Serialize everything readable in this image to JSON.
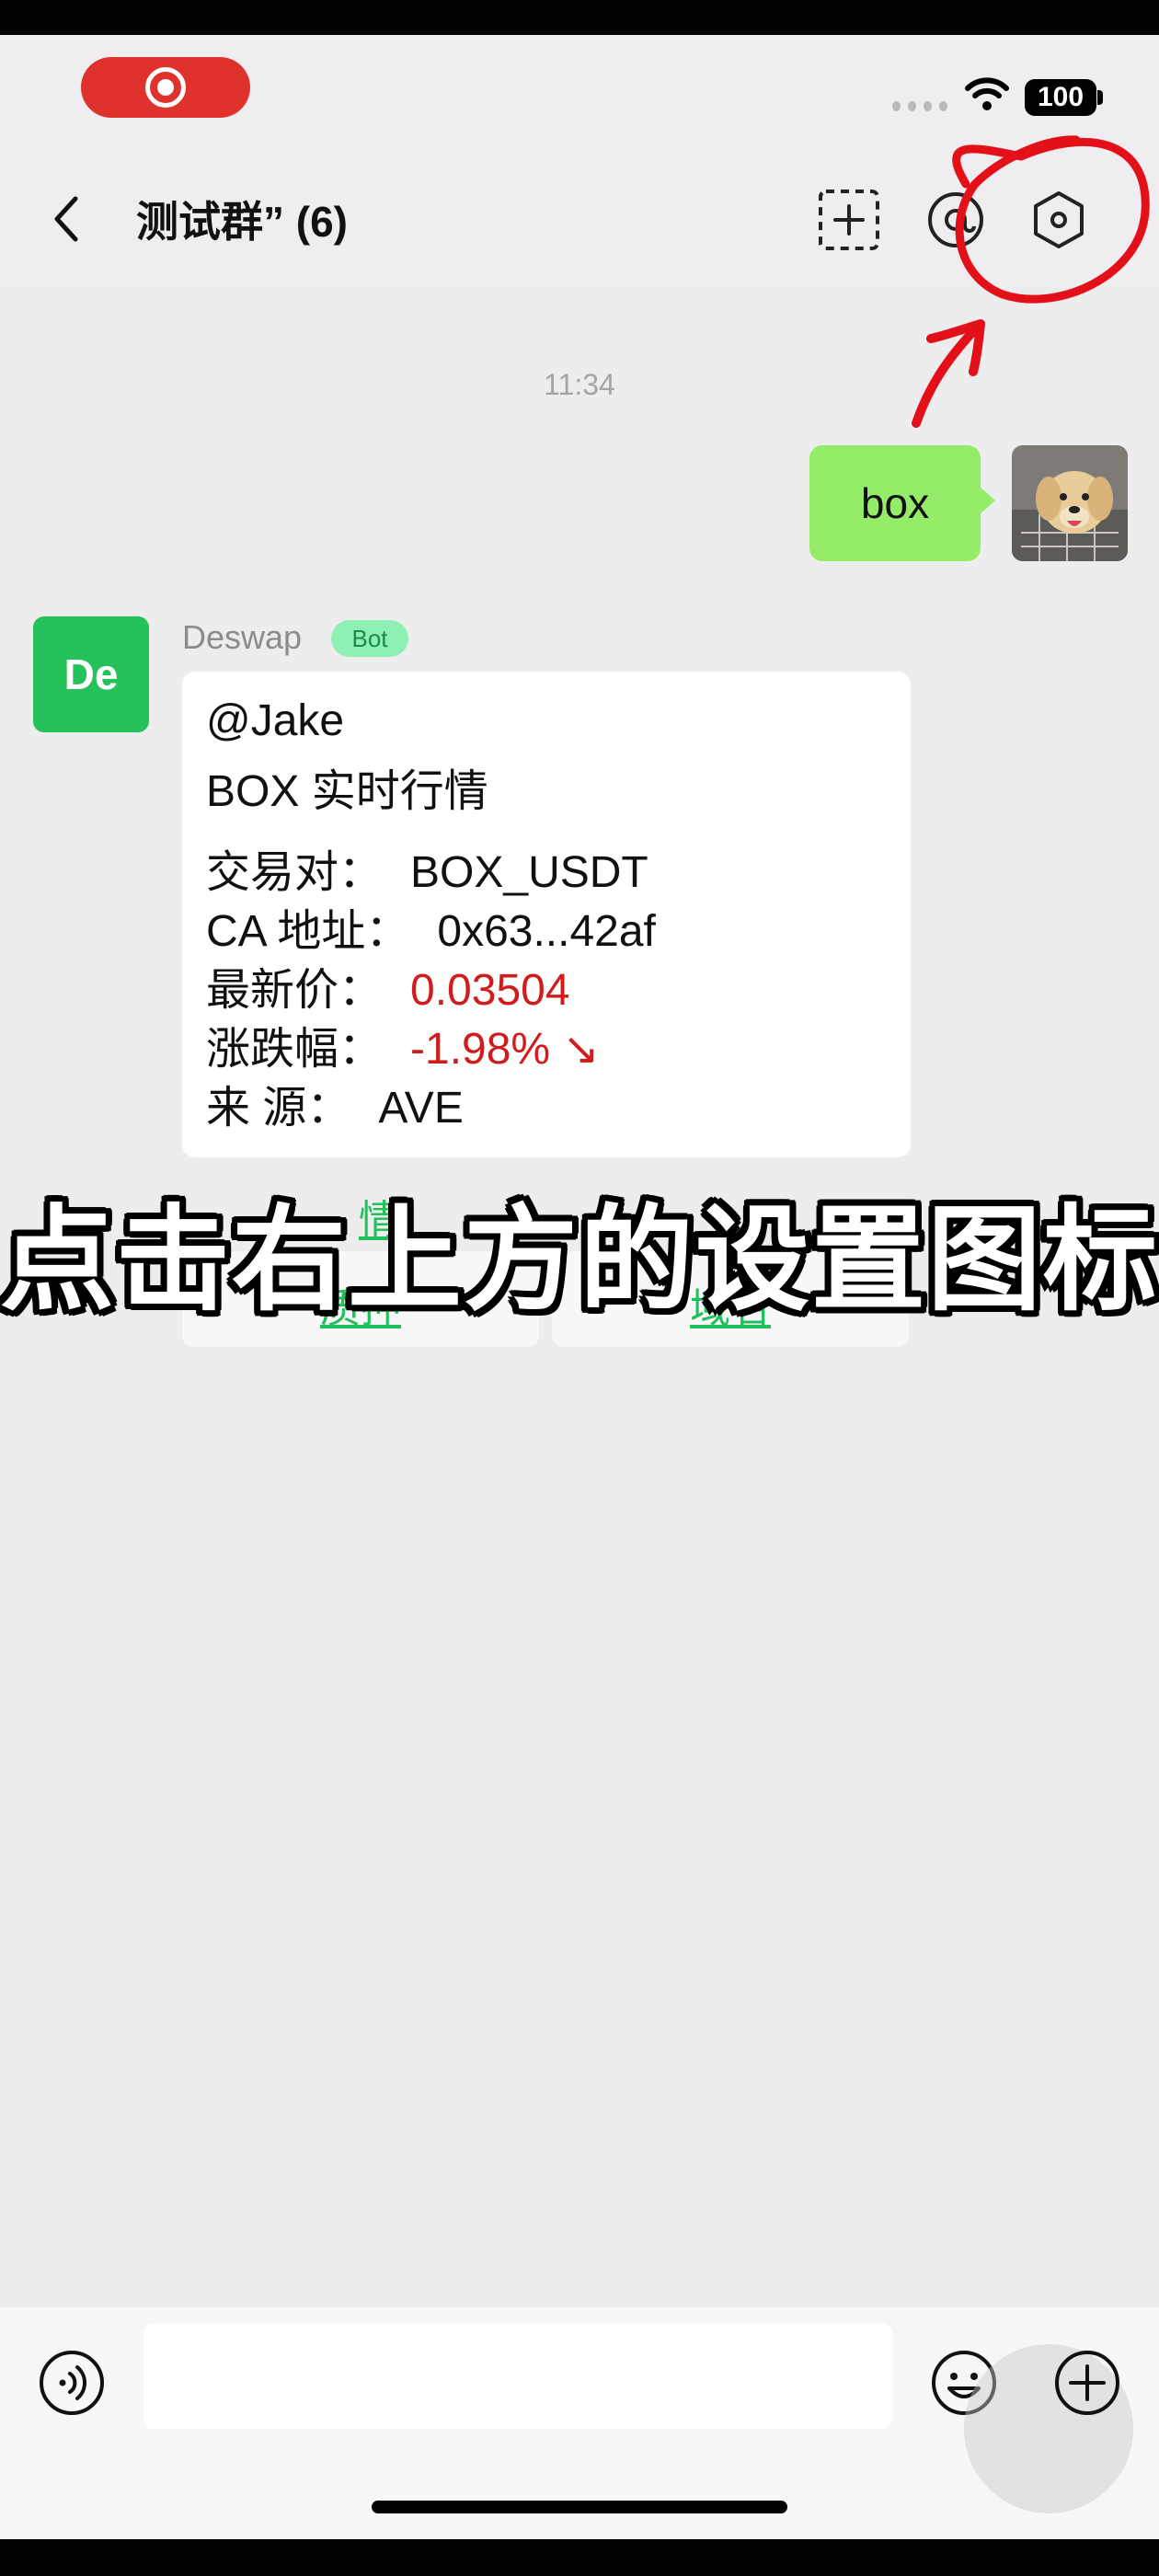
{
  "status_bar": {
    "battery": "100"
  },
  "nav": {
    "title": "测试群” (6)"
  },
  "chat": {
    "time": "11:34",
    "outgoing": {
      "text": "box"
    },
    "incoming": {
      "avatar_text": "De",
      "sender": "Deswap",
      "badge": "Bot",
      "card": {
        "mention": "@Jake",
        "heading": "BOX 实时行情",
        "rows": [
          {
            "label": "交易对：",
            "value": "BOX_USDT"
          },
          {
            "label": "CA 地址：",
            "value": "0x63...42af"
          },
          {
            "label": "最新价：",
            "value": "0.03504"
          },
          {
            "label": "涨跌幅：",
            "value": "-1.98% ↘"
          },
          {
            "label": "来  源：",
            "value": "AVE"
          }
        ]
      },
      "buttons": {
        "partial_left": "情",
        "stake": "质押",
        "domain": "域名"
      }
    }
  },
  "overlay": {
    "caption": "点击右上方的设置图标"
  },
  "colors": {
    "bubble_green": "#95ec69",
    "bot_green": "#25c15b",
    "link_green": "#20c05c",
    "price_red": "#d01c1c",
    "annotation_red": "#e3101a"
  },
  "icons": [
    "back-icon",
    "add-member-icon",
    "call-icon",
    "settings-icon",
    "wifi-icon",
    "voice-icon",
    "emoji-icon",
    "plus-icon"
  ]
}
